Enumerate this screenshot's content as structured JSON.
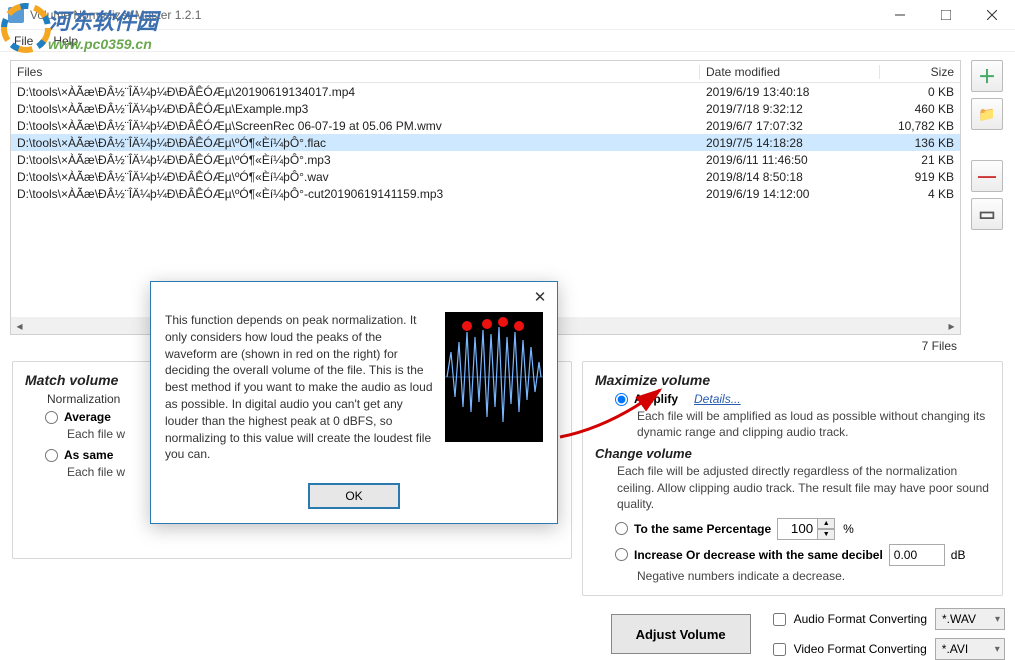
{
  "window": {
    "title": "Volume Normalizer Master 1.2.1"
  },
  "menu": {
    "file": "File",
    "help": "Help"
  },
  "watermark": {
    "cn": "河东软件园",
    "url": "www.pc0359.cn"
  },
  "file_list": {
    "headers": {
      "files": "Files",
      "date": "Date modified",
      "size": "Size"
    },
    "rows": [
      {
        "path": "D:\\tools\\×ÀÃæ\\ÐÂ½¨ÎÄ¼þ¼Ð\\ÐÂÊÓÆµ\\20190619134017.mp4",
        "date": "2019/6/19 13:40:18",
        "size": "0 KB",
        "sel": false
      },
      {
        "path": "D:\\tools\\×ÀÃæ\\ÐÂ½¨ÎÄ¼þ¼Ð\\ÐÂÊÓÆµ\\Example.mp3",
        "date": "2019/7/18 9:32:12",
        "size": "460 KB",
        "sel": false
      },
      {
        "path": "D:\\tools\\×ÀÃæ\\ÐÂ½¨ÎÄ¼þ¼Ð\\ÐÂÊÓÆµ\\ScreenRec 06-07-19 at 05.06 PM.wmv",
        "date": "2019/6/7 17:07:32",
        "size": "10,782 KB",
        "sel": false
      },
      {
        "path": "D:\\tools\\×ÀÃæ\\ÐÂ½¨ÎÄ¼þ¼Ð\\ÐÂÊÓÆµ\\ºÓ¶«Èí¼þÔ°.flac",
        "date": "2019/7/5 14:18:28",
        "size": "136 KB",
        "sel": true
      },
      {
        "path": "D:\\tools\\×ÀÃæ\\ÐÂ½¨ÎÄ¼þ¼Ð\\ÐÂÊÓÆµ\\ºÓ¶«Èí¼þÔ°.mp3",
        "date": "2019/6/11 11:46:50",
        "size": "21 KB",
        "sel": false
      },
      {
        "path": "D:\\tools\\×ÀÃæ\\ÐÂ½¨ÎÄ¼þ¼Ð\\ÐÂÊÓÆµ\\ºÓ¶«Èí¼þÔ°.wav",
        "date": "2019/8/14 8:50:18",
        "size": "919 KB",
        "sel": false
      },
      {
        "path": "D:\\tools\\×ÀÃæ\\ÐÂ½¨ÎÄ¼þ¼Ð\\ÐÂÊÓÆµ\\ºÓ¶«Èí¼þÔ°-cut20190619141159.mp3",
        "date": "2019/6/19 14:12:00",
        "size": "4 KB",
        "sel": false
      }
    ],
    "count": "7 Files"
  },
  "match": {
    "title": "Match volume",
    "norm_label": "Normalization",
    "average": "Average",
    "average_desc": "Each file w",
    "as_same": "As same",
    "as_same_desc": "Each file w"
  },
  "max": {
    "title": "Maximize volume",
    "amplify": "Amplify",
    "details": "Details...",
    "amplify_desc": "Each file will be amplified as loud as possible without changing its dynamic range and clipping audio track.",
    "change_title": "Change volume",
    "change_desc": "Each file will be adjusted directly regardless of the normalization ceiling. Allow clipping audio track. The result file may have poor sound quality.",
    "to_pct": "To the same Percentage",
    "pct_value": "100",
    "pct_suffix": "%",
    "inc_dec": "Increase Or decrease with the same decibel",
    "db_value": "0.00",
    "db_suffix": "dB",
    "neg_note": "Negative numbers indicate a decrease."
  },
  "actions": {
    "adjust": "Adjust Volume",
    "audio_conv": "Audio Format Converting",
    "audio_fmt": "*.WAV",
    "video_conv": "Video Format Converting",
    "video_fmt": "*.AVI"
  },
  "dialog": {
    "text": "This function depends on peak normalization. It only considers how loud the peaks of the waveform are (shown in red on the right) for deciding the overall volume of the file. This is the best method if you want to make the audio as loud as possible. In digital audio you can't get any louder than the highest peak at 0 dBFS, so normalizing to this value will create the loudest file you can.",
    "ok": "OK"
  }
}
